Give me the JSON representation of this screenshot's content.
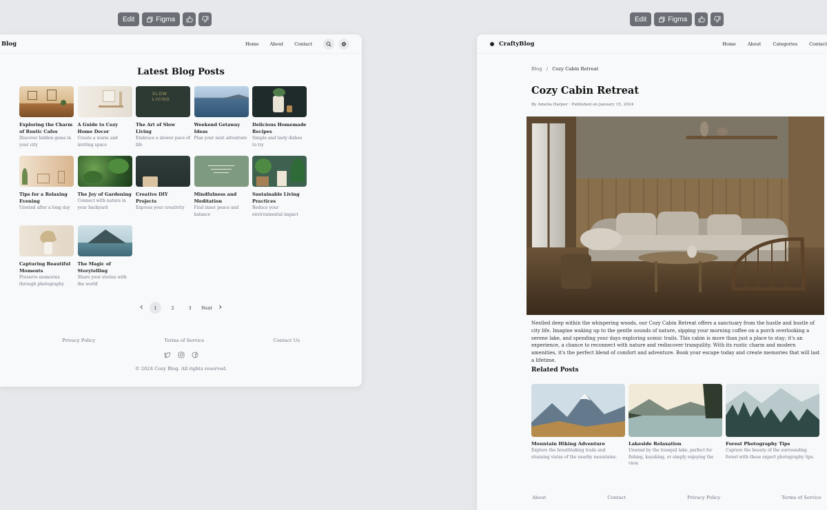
{
  "toolbar": {
    "edit": "Edit",
    "figma": "Figma"
  },
  "left": {
    "brand": "Blog",
    "nav": [
      "Home",
      "About",
      "Contact"
    ],
    "heading": "Latest Blog Posts",
    "posts": [
      {
        "title": "Exploring the Charm of Rustic Cafes",
        "desc": "Discover hidden gems in your city"
      },
      {
        "title": "A Guide to Cozy Home Decor",
        "desc": "Create a warm and inviting space"
      },
      {
        "title": "The Art of Slow Living",
        "desc": "Embrace a slower pace of life"
      },
      {
        "title": "Weekend Getaway Ideas",
        "desc": "Plan your next adventure"
      },
      {
        "title": "Delicious Homemade Recipes",
        "desc": "Simple and tasty dishes to try"
      },
      {
        "title": "Tips for a Relaxing Evening",
        "desc": "Unwind after a long day"
      },
      {
        "title": "The Joy of Gardening",
        "desc": "Connect with nature in your backyard"
      },
      {
        "title": "Creative DIY Projects",
        "desc": "Express your creativity"
      },
      {
        "title": "Mindfulness and Meditation",
        "desc": "Find inner peace and balance"
      },
      {
        "title": "Sustainable Living Practices",
        "desc": "Reduce your environmental impact"
      },
      {
        "title": "Capturing Beautiful Moments",
        "desc": "Preserve memories through photography"
      },
      {
        "title": "The Magic of Storytelling",
        "desc": "Share your stories with the world"
      }
    ],
    "thumb_text": {
      "slow_living_1": "SLOW",
      "slow_living_2": "LIVING"
    },
    "pagination": {
      "pages": [
        "1",
        "2",
        "3"
      ],
      "next": "Next",
      "current": "1"
    },
    "footer": {
      "links": [
        "Privacy Policy",
        "Terms of Service",
        "Contact Us"
      ],
      "social": [
        "twitter-icon",
        "instagram-icon",
        "facebook-icon"
      ],
      "copyright": "© 2024 Cozy Blog. All rights reserved."
    }
  },
  "right": {
    "brand": "CraftyBlog",
    "nav": [
      "Home",
      "About",
      "Categories",
      "Contact"
    ],
    "breadcrumb": {
      "root": "Blog",
      "sep": "/",
      "current": "Cozy Cabin Retreat"
    },
    "title": "Cozy Cabin Retreat",
    "byline": "By Amelia Harper · Published on January 15, 2024",
    "body": "Nestled deep within the whispering woods, our Cozy Cabin Retreat offers a sanctuary from the hustle and bustle of city life. Imagine waking up to the gentle sounds of nature, sipping your morning coffee on a porch overlooking a serene lake, and spending your days exploring scenic trails. This cabin is more than just a place to stay; it's an experience, a chance to reconnect with nature and rediscover tranquility. With its rustic charm and modern amenities, it's the perfect blend of comfort and adventure. Book your escape today and create memories that will last a lifetime.",
    "related_heading": "Related Posts",
    "related": [
      {
        "title": "Mountain Hiking Adventure",
        "desc": "Explore the breathtaking trails and stunning vistas of the nearby mountains."
      },
      {
        "title": "Lakeside Relaxation",
        "desc": "Unwind by the tranquil lake, perfect for fishing, kayaking, or simply enjoying the view."
      },
      {
        "title": "Forest Photography Tips",
        "desc": "Capture the beauty of the surrounding forest with these expert photography tips."
      }
    ],
    "footer": [
      "About",
      "Contact",
      "Privacy Policy",
      "Terms of Service"
    ]
  }
}
